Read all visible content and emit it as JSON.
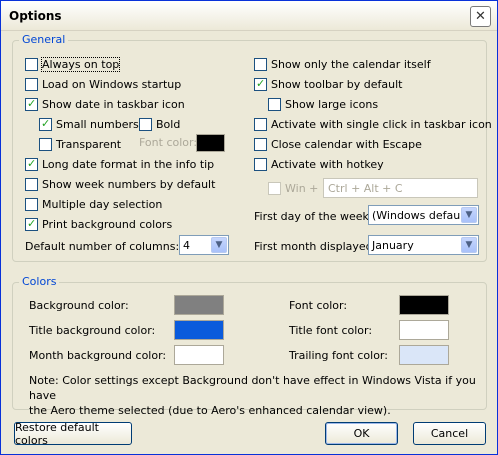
{
  "window": {
    "title": "Options",
    "close_glyph": "✕"
  },
  "general": {
    "legend": "General",
    "always_on_top": "Always on top",
    "load_on_startup": "Load on Windows startup",
    "show_date_taskbar": "Show date in taskbar icon",
    "small_numbers": "Small numbers",
    "bold": "Bold",
    "font_color_label": "Font color:",
    "transparent": "Transparent",
    "long_date_format": "Long date format in the info tip",
    "show_week_numbers": "Show week numbers by default",
    "multiple_day_selection": "Multiple day selection",
    "print_background_colors": "Print background colors",
    "default_columns_label": "Default number of columns:",
    "default_columns_value": "4",
    "show_only_calendar": "Show only the calendar itself",
    "show_toolbar": "Show toolbar by default",
    "show_large_icons": "Show large icons",
    "activate_single_click": "Activate with single click in taskbar icon",
    "close_with_escape": "Close calendar with Escape",
    "activate_hotkey": "Activate with hotkey",
    "win_plus": "Win +",
    "hotkey_value": "Ctrl + Alt + C",
    "first_day_label": "First day of the week:",
    "first_day_value": "(Windows default)",
    "first_month_label": "First month displayed:",
    "first_month_value": "January"
  },
  "colors": {
    "legend": "Colors",
    "background_color": "Background color:",
    "title_background_color": "Title background color:",
    "month_background_color": "Month background color:",
    "font_color": "Font color:",
    "title_font_color": "Title font color:",
    "trailing_font_color": "Trailing font color:",
    "swatches": {
      "background": "#808080",
      "title_background": "#0a5bdc",
      "month_background": "#ffffff",
      "font": "#000000",
      "title_font": "#ffffff",
      "trailing_font": "#dae6f8",
      "taskbar_font": "#000000"
    },
    "note_line1": "Note: Color settings except Background don't have effect in Windows Vista if you have",
    "note_line2": "the Aero theme selected (due to Aero's enhanced calendar view)."
  },
  "buttons": {
    "restore": "Restore default colors",
    "ok": "OK",
    "cancel": "Cancel"
  }
}
